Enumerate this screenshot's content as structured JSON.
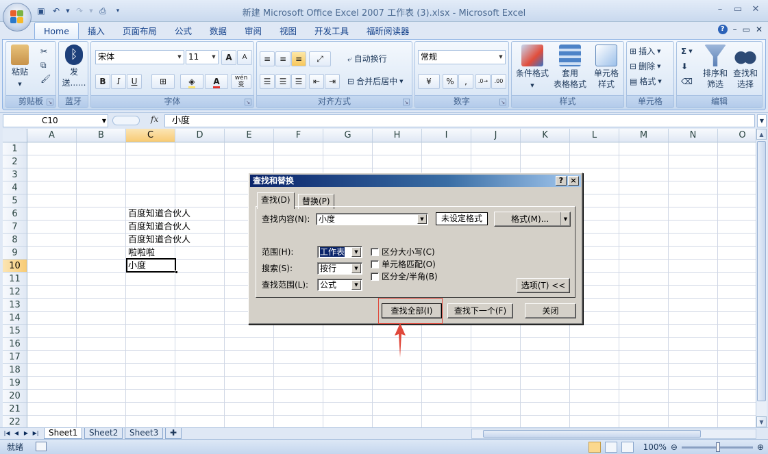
{
  "window": {
    "title": "新建 Microsoft Office Excel 2007 工作表 (3).xlsx - Microsoft Excel"
  },
  "ribbon_tabs": [
    "Home",
    "插入",
    "页面布局",
    "公式",
    "数据",
    "审阅",
    "视图",
    "开发工具",
    "福昕阅读器"
  ],
  "clipboard": {
    "paste": "粘贴",
    "label": "剪贴板"
  },
  "bluetooth": {
    "send": "发",
    "send2": "送......",
    "label": "蓝牙"
  },
  "font": {
    "name": "宋体",
    "size": "11",
    "bold": "B",
    "italic": "I",
    "underline": "U",
    "grow": "A",
    "shrink": "A",
    "wen": "wén",
    "wen2": "变",
    "label": "字体",
    "color_accent": "#e4312b",
    "fill_accent": "#fde36b"
  },
  "alignment": {
    "wrap": "自动换行",
    "merge": "合并后居中",
    "label": "对齐方式"
  },
  "number": {
    "format": "常规",
    "percent": "%",
    "comma": ",",
    "label": "数字"
  },
  "styles": {
    "cond1": "条件格式",
    "table1": "套用",
    "table2": "表格格式",
    "cell1": "单元格",
    "cell2": "样式",
    "label": "样式"
  },
  "cells": {
    "insert": "插入",
    "delete": "删除",
    "format": "格式",
    "label": "单元格"
  },
  "editing": {
    "sigma": "Σ",
    "sort1": "排序和",
    "sort2": "筛选",
    "find1": "查找和",
    "find2": "选择",
    "label": "编辑"
  },
  "formula_bar": {
    "name_box": "C10",
    "fx": "fx",
    "content": "小度"
  },
  "columns": [
    "A",
    "B",
    "C",
    "D",
    "E",
    "F",
    "G",
    "H",
    "I",
    "J",
    "K",
    "L",
    "M",
    "N",
    "O"
  ],
  "rows": [
    "1",
    "2",
    "3",
    "4",
    "5",
    "6",
    "7",
    "8",
    "9",
    "10",
    "11",
    "12",
    "13",
    "14",
    "15",
    "16",
    "17",
    "18",
    "19",
    "20",
    "21",
    "22"
  ],
  "cell_values": [
    {
      "ref": "C6",
      "value": "百度知道合伙人"
    },
    {
      "ref": "C7",
      "value": "百度知道合伙人"
    },
    {
      "ref": "C8",
      "value": "百度知道合伙人"
    },
    {
      "ref": "C9",
      "value": "啦啦啦"
    },
    {
      "ref": "C10",
      "value": "小度"
    }
  ],
  "sheets": [
    "Sheet1",
    "Sheet2",
    "Sheet3"
  ],
  "status": {
    "ready": "就绪",
    "zoom": "100%"
  },
  "dialog": {
    "title": "查找和替换",
    "help": "?",
    "close": "×",
    "tab_find": "查找(D)",
    "tab_replace": "替换(P)",
    "find_label": "查找内容(N):",
    "find_value": "小度",
    "no_format": "未设定格式",
    "format_btn": "格式(M)...",
    "scope_label": "范围(H):",
    "scope_value": "工作表",
    "search_label": "搜索(S):",
    "search_value": "按行",
    "lookin_label": "查找范围(L):",
    "lookin_value": "公式",
    "match_case": "区分大小写(C)",
    "match_cell": "单元格匹配(O)",
    "match_width": "区分全/半角(B)",
    "options_btn": "选项(T) <<",
    "find_all": "查找全部(I)",
    "find_next": "查找下一个(F)",
    "close_btn": "关闭"
  },
  "annotation_color": "#e0483b"
}
